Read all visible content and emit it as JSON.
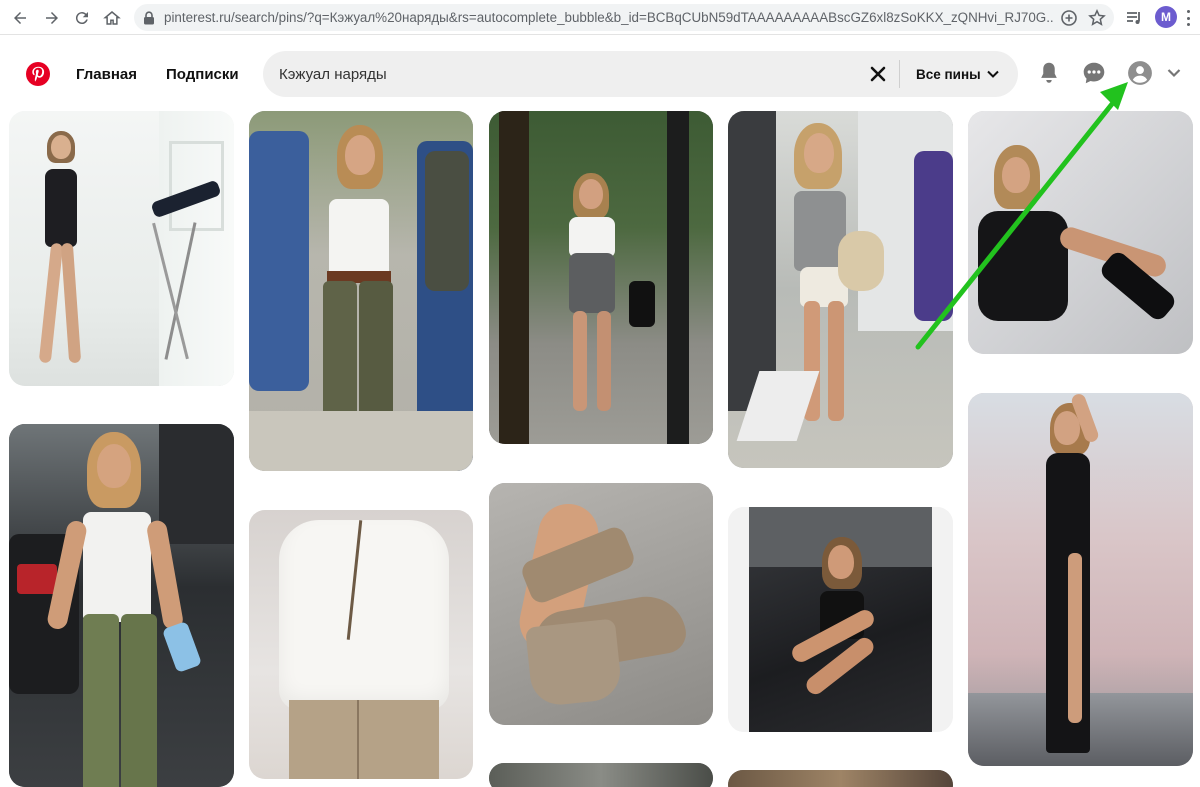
{
  "browser": {
    "url": "pinterest.ru/search/pins/?q=Кэжуал%20наряды&rs=autocomplete_bubble&b_id=BCBqCUbN59dTAAAAAAAAABscGZ6xl8zSoKKX_zQNHvi_RJ70G...",
    "profile_initial": "M",
    "icons": [
      "back-icon",
      "forward-icon",
      "reload-icon",
      "home-icon",
      "lock-icon",
      "add-icon",
      "star-icon",
      "playlist-icon",
      "profile-icon",
      "more-icon"
    ]
  },
  "header": {
    "nav_home": "Главная",
    "nav_following": "Подписки",
    "search_value": "Кэжуал наряды",
    "filter_label": "Все пины",
    "brand_color": "#e60023"
  },
  "pins": [
    {
      "id": "pin-1",
      "desc": "black swimsuit, telescope, white room"
    },
    {
      "id": "pin-2",
      "desc": "white tank top, olive cargo pants, street"
    },
    {
      "id": "pin-3",
      "desc": "white blouse, grey skirt, park"
    },
    {
      "id": "pin-4",
      "desc": "grey t-shirt, white shorts, street"
    },
    {
      "id": "pin-5",
      "desc": "black dress, knee boots, grey wall"
    },
    {
      "id": "pin-6",
      "desc": "white tank top, green pants, cars"
    },
    {
      "id": "pin-7",
      "desc": "white shirt, beige trousers"
    },
    {
      "id": "pin-8",
      "desc": "espadrille wedge sandal"
    },
    {
      "id": "pin-9",
      "desc": "black dress, car"
    },
    {
      "id": "pin-10",
      "desc": "long black dress, pink sky, sea"
    }
  ],
  "annotation": {
    "arrow_color": "#22c21e"
  }
}
